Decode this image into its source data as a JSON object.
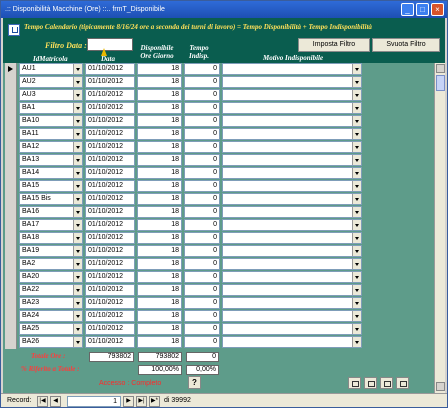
{
  "window": {
    "title": ".:: Disponibilità Macchine (Ore) ::..     frmT_Disponibile"
  },
  "header": {
    "banner": "Tempo Calendario (tipicamente  8/16/24 ore a seconda dei turni di lavoro) =  Tempo Disponibilità + Tempo Indisponibilità",
    "filter_label": "Filtro Data :",
    "filter_value": "",
    "btn_set_filter": "Imposta Filtro",
    "btn_clear_filter": "Svuota Filtro",
    "columns": {
      "id": "IdMatricola",
      "date": "Data",
      "avail": "Disponibile\nOre Giorno",
      "unavail": "Tempo\nIndisp.",
      "reason": "Motivo Indisponibile"
    }
  },
  "rows": [
    {
      "id": "AU1",
      "date": "01/10/2012",
      "avail": "18",
      "unavail": "0",
      "reason": ""
    },
    {
      "id": "AU2",
      "date": "01/10/2012",
      "avail": "18",
      "unavail": "0",
      "reason": ""
    },
    {
      "id": "AU3",
      "date": "01/10/2012",
      "avail": "18",
      "unavail": "0",
      "reason": ""
    },
    {
      "id": "BA1",
      "date": "01/10/2012",
      "avail": "18",
      "unavail": "0",
      "reason": ""
    },
    {
      "id": "BA10",
      "date": "01/10/2012",
      "avail": "18",
      "unavail": "0",
      "reason": ""
    },
    {
      "id": "BA11",
      "date": "01/10/2012",
      "avail": "18",
      "unavail": "0",
      "reason": ""
    },
    {
      "id": "BA12",
      "date": "01/10/2012",
      "avail": "18",
      "unavail": "0",
      "reason": ""
    },
    {
      "id": "BA13",
      "date": "01/10/2012",
      "avail": "18",
      "unavail": "0",
      "reason": ""
    },
    {
      "id": "BA14",
      "date": "01/10/2012",
      "avail": "18",
      "unavail": "0",
      "reason": ""
    },
    {
      "id": "BA15",
      "date": "01/10/2012",
      "avail": "18",
      "unavail": "0",
      "reason": ""
    },
    {
      "id": "BA15 Bis",
      "date": "01/10/2012",
      "avail": "18",
      "unavail": "0",
      "reason": ""
    },
    {
      "id": "BA16",
      "date": "01/10/2012",
      "avail": "18",
      "unavail": "0",
      "reason": ""
    },
    {
      "id": "BA17",
      "date": "01/10/2012",
      "avail": "18",
      "unavail": "0",
      "reason": ""
    },
    {
      "id": "BA18",
      "date": "01/10/2012",
      "avail": "18",
      "unavail": "0",
      "reason": ""
    },
    {
      "id": "BA19",
      "date": "01/10/2012",
      "avail": "18",
      "unavail": "0",
      "reason": ""
    },
    {
      "id": "BA2",
      "date": "01/10/2012",
      "avail": "18",
      "unavail": "0",
      "reason": ""
    },
    {
      "id": "BA20",
      "date": "01/10/2012",
      "avail": "18",
      "unavail": "0",
      "reason": ""
    },
    {
      "id": "BA22",
      "date": "01/10/2012",
      "avail": "18",
      "unavail": "0",
      "reason": ""
    },
    {
      "id": "BA23",
      "date": "01/10/2012",
      "avail": "18",
      "unavail": "0",
      "reason": ""
    },
    {
      "id": "BA24",
      "date": "01/10/2012",
      "avail": "18",
      "unavail": "0",
      "reason": ""
    },
    {
      "id": "BA25",
      "date": "01/10/2012",
      "avail": "18",
      "unavail": "0",
      "reason": ""
    },
    {
      "id": "BA26",
      "date": "01/10/2012",
      "avail": "18",
      "unavail": "0",
      "reason": ""
    }
  ],
  "totals": {
    "label": "Totale Ore :",
    "total1": "793802",
    "total2": "793802",
    "total3": "0",
    "pct_label": "% Riferito a Totale :",
    "pct1": "100,00%",
    "pct2": "0,00%",
    "access": "Accesso : Completo",
    "help": "?"
  },
  "nav": {
    "label": "Record:",
    "current": "1",
    "of": "di 39992"
  }
}
